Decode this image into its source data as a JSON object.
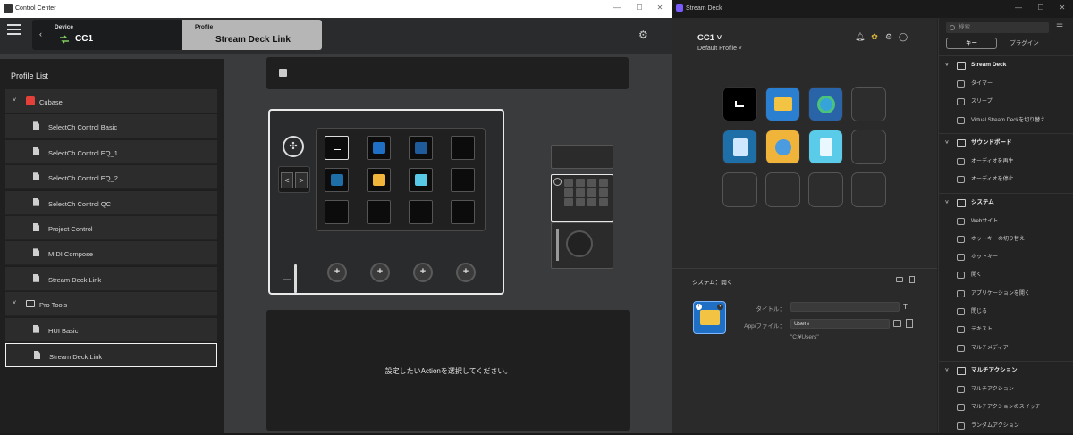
{
  "control_center": {
    "window_title": "Control Center",
    "device_label": "Device",
    "device_name": "CC1",
    "profile_label": "Profile",
    "profile_name": "Stream Deck Link",
    "profile_list_title": "Profile List",
    "profiles": [
      {
        "name": "Cubase",
        "type": "folder"
      },
      {
        "name": "SelectCh Control Basic",
        "type": "item"
      },
      {
        "name": "SelectCh Control EQ_1",
        "type": "item"
      },
      {
        "name": "SelectCh Control EQ_2",
        "type": "item"
      },
      {
        "name": "SelectCh Control QC",
        "type": "item"
      },
      {
        "name": "Project Control",
        "type": "item"
      },
      {
        "name": "MIDI Compose",
        "type": "item"
      },
      {
        "name": "Stream Deck Link",
        "type": "item"
      },
      {
        "name": "Pro Tools",
        "type": "folder"
      },
      {
        "name": "HUI Basic",
        "type": "item"
      },
      {
        "name": "Stream Deck Link",
        "type": "item",
        "selected": true
      }
    ],
    "action_message": "設定したいActionを選択してください。",
    "minimize": "—",
    "maximize": "☐",
    "close": "✕",
    "nav_left": "<",
    "nav_right": ">",
    "knob_symbol": "+"
  },
  "stream_deck": {
    "window_title": "Stream Deck",
    "device_name": "CC1 ˅",
    "profile": "Default Profile ˅",
    "section_label": "システム：開く",
    "title_label": "タイトル：",
    "title_value": "",
    "app_label": "App/ファイル：",
    "app_value": "Users",
    "path_text": "\"C:¥Users\"",
    "search_placeholder": "検索",
    "tab_keys": "キー",
    "tab_plugins": "プラグイン",
    "categories": [
      {
        "name": "Stream Deck",
        "items": [
          "タイマー",
          "スリープ",
          "Virtual Stream Deckを切り替え"
        ]
      },
      {
        "name": "サウンドボード",
        "items": [
          "オーディオを再生",
          "オーディオを停止"
        ]
      },
      {
        "name": "システム",
        "items": [
          "Webサイト",
          "ホットキーの切り替え",
          "ホットキー",
          "開く",
          "アプリケーションを開く",
          "閉じる",
          "テキスト",
          "マルチメディア"
        ]
      },
      {
        "name": "マルチアクション",
        "items": [
          "マルチアクション",
          "マルチアクションのスイッチ",
          "ランダムアクション"
        ]
      }
    ],
    "keys": [
      "terminal",
      "folder",
      "edge",
      "",
      "notepad",
      "paint",
      "calculator",
      "",
      "",
      "",
      "",
      ""
    ],
    "accent": "#1f6fc4"
  }
}
